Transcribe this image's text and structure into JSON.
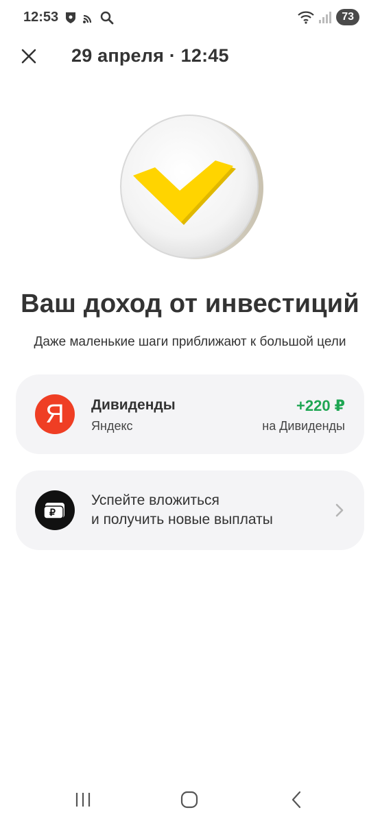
{
  "status_bar": {
    "time": "12:53",
    "battery": "73",
    "icons_left": [
      "shield-icon",
      "cast-icon",
      "search-icon"
    ],
    "icons_right": [
      "wifi-icon",
      "signal-icon"
    ]
  },
  "header": {
    "title": "29 апреля · 12:45"
  },
  "hero": {
    "icon": "checkmark-coin-icon",
    "accent": "#ffd400"
  },
  "content": {
    "title": "Ваш доход от инвестиций",
    "subtitle": "Даже маленькие шаги приближают к большой цели"
  },
  "dividend_card": {
    "logo_letter": "Я",
    "name": "Дивиденды",
    "company": "Яндекс",
    "amount": "+220 ₽",
    "destination": "на Дивиденды",
    "amount_color": "#1fa653",
    "logo_color": "#ef3e24"
  },
  "invest_card": {
    "line1": "Успейте вложиться",
    "line2": "и получить новые выплаты",
    "icon": "ruble-wallet-icon"
  },
  "nav_bar": {
    "items": [
      "recent-apps-icon",
      "home-icon",
      "back-icon"
    ]
  }
}
